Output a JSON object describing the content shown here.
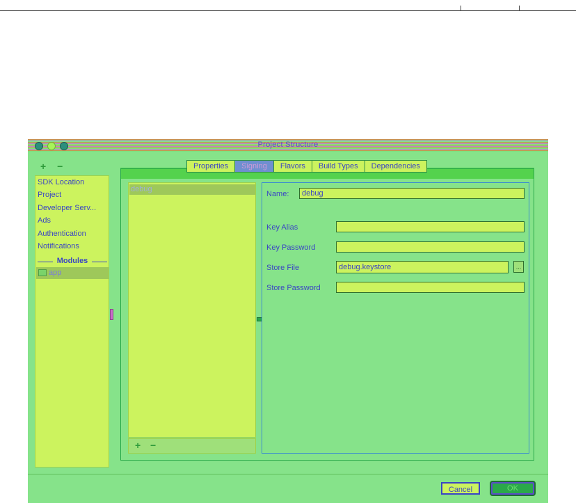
{
  "window": {
    "title": "Project Structure"
  },
  "sidebar": {
    "add_label": "+",
    "remove_label": "−",
    "items": [
      {
        "label": "SDK Location"
      },
      {
        "label": "Project"
      },
      {
        "label": "Developer Serv..."
      },
      {
        "label": "Ads"
      },
      {
        "label": "Authentication"
      },
      {
        "label": "Notifications"
      }
    ],
    "section_label": "Modules",
    "selected_module": "app"
  },
  "tabs": [
    {
      "label": "Properties"
    },
    {
      "label": "Signing",
      "active": true
    },
    {
      "label": "Flavors"
    },
    {
      "label": "Build Types"
    },
    {
      "label": "Dependencies"
    }
  ],
  "configs": {
    "selected": "debug",
    "add_label": "+",
    "remove_label": "−"
  },
  "form": {
    "name_label": "Name:",
    "name_value": "debug",
    "key_alias_label": "Key Alias",
    "key_alias_value": "",
    "key_password_label": "Key Password",
    "key_password_value": "",
    "store_file_label": "Store File",
    "store_file_value": "debug.keystore",
    "browse_label": "...",
    "store_password_label": "Store Password",
    "store_password_value": ""
  },
  "footer": {
    "cancel_label": "Cancel",
    "ok_label": "OK"
  }
}
